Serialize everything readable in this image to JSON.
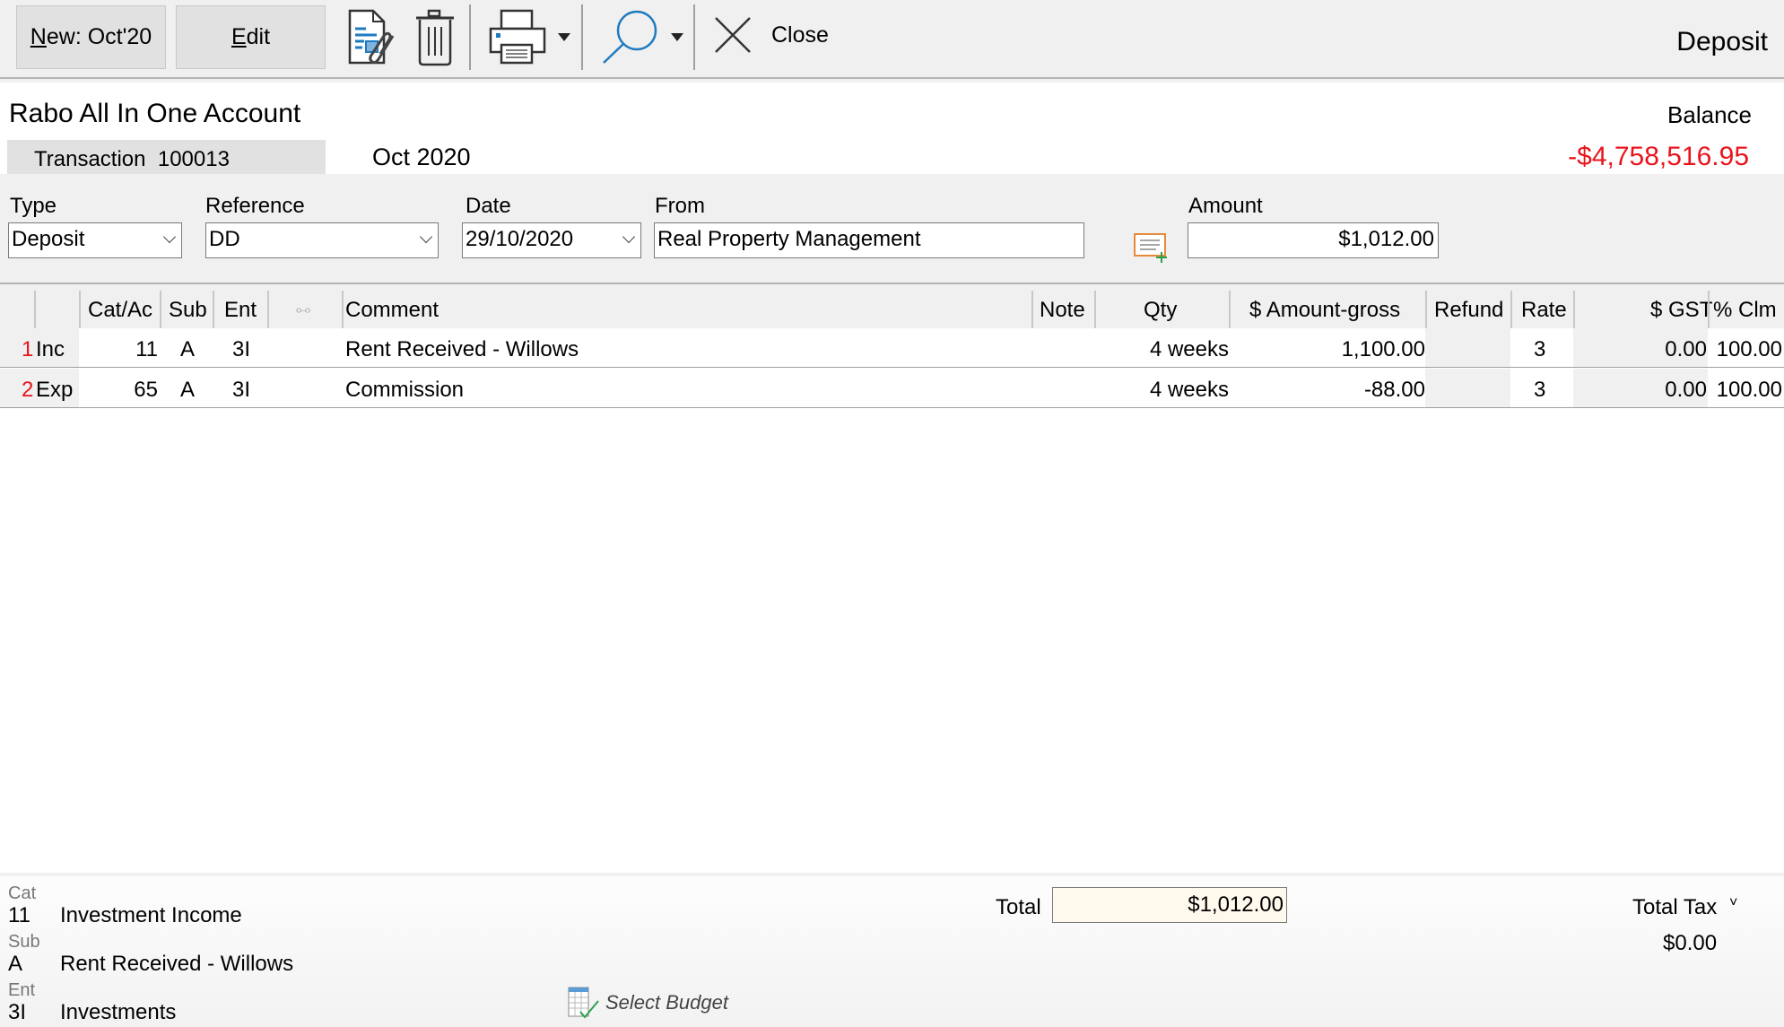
{
  "toolbar": {
    "new_button": {
      "accel": "N",
      "label_rest": "ew: Oct'20"
    },
    "edit_button": {
      "accel": "E",
      "label_rest": "dit"
    },
    "icons": [
      "attach-document-icon",
      "delete-trash-icon",
      "print-icon",
      "search-icon",
      "close-icon"
    ],
    "close_label": "Close",
    "form_title": "Deposit"
  },
  "header": {
    "account": "Rabo All In One Account",
    "transaction_label": "Transaction",
    "transaction_number": "100013",
    "period": "Oct 2020",
    "balance_label": "Balance",
    "balance_value": "-$4,758,516.95",
    "balance_color": "#e8141b"
  },
  "fields": {
    "type": {
      "label": "Type",
      "value": "Deposit"
    },
    "reference": {
      "label": "Reference",
      "value": "DD"
    },
    "date": {
      "label": "Date",
      "value": "29/10/2020"
    },
    "from": {
      "label": "From",
      "value": "Real Property Management"
    },
    "amount": {
      "label": "Amount",
      "value": "$1,012.00"
    }
  },
  "grid": {
    "headers": {
      "cat": "Cat/Ac",
      "sub": "Sub",
      "ent": "Ent",
      "link": "⧟",
      "comment": "Comment",
      "note": "Note",
      "qty": "Qty",
      "amount": "$ Amount-gross",
      "refund": "Refund",
      "rate": "Rate",
      "gst": "$ GST",
      "clm": "% Clm"
    },
    "rows": [
      {
        "num": "1",
        "kind": "Inc",
        "cat": "11",
        "sub": "A",
        "ent": "3I",
        "comment": "Rent Received - Willows",
        "note": "",
        "qty": "4 weeks",
        "amount": "1,100.00",
        "refund": "",
        "rate": "3",
        "gst": "0.00",
        "clm": "100.00"
      },
      {
        "num": "2",
        "kind": "Exp",
        "cat": "65",
        "sub": "A",
        "ent": "3I",
        "comment": "Commission",
        "note": "",
        "qty": "4 weeks",
        "amount": "-88.00",
        "refund": "",
        "rate": "3",
        "gst": "0.00",
        "clm": "100.00"
      }
    ]
  },
  "footer": {
    "cat_label": "Cat",
    "cat_code": "11",
    "cat_name": "Investment Income",
    "sub_label": "Sub",
    "sub_code": "A",
    "sub_name": "Rent Received - Willows",
    "ent_label": "Ent",
    "ent_code": "3I",
    "ent_name": "Investments",
    "select_budget": "Select Budget",
    "total_label": "Total",
    "total_value": "$1,012.00",
    "total_tax_label": "Total Tax",
    "total_tax_value": "$0.00"
  }
}
